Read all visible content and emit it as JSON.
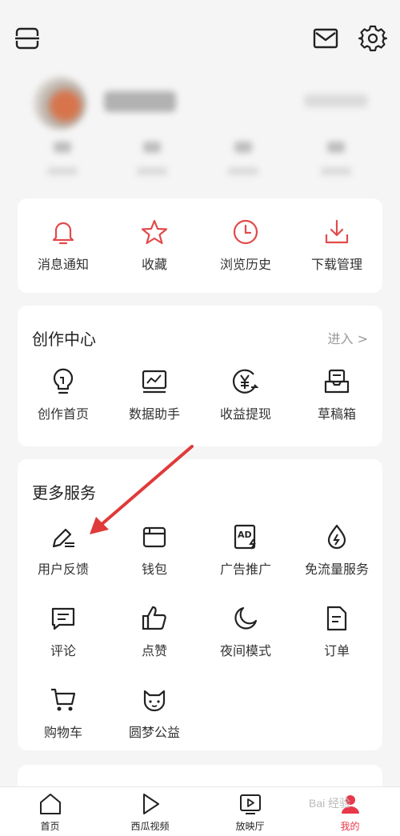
{
  "colors": {
    "accent_red": "#e24a4a",
    "icon_dark": "#222222",
    "muted": "#999999",
    "background": "#f5f5f5"
  },
  "topbar": {
    "scan_icon": "scan-icon",
    "mail_icon": "mail-icon",
    "settings_icon": "gear-icon"
  },
  "profile": {
    "blurred": true,
    "avatar_icon": "avatar"
  },
  "quick_actions": [
    {
      "label": "消息通知",
      "icon": "bell-icon"
    },
    {
      "label": "收藏",
      "icon": "star-icon"
    },
    {
      "label": "浏览历史",
      "icon": "clock-icon"
    },
    {
      "label": "下载管理",
      "icon": "download-icon"
    }
  ],
  "creator": {
    "title": "创作中心",
    "enter": "进入 >",
    "items": [
      {
        "label": "创作首页",
        "icon": "lightbulb-icon"
      },
      {
        "label": "数据助手",
        "icon": "chart-icon"
      },
      {
        "label": "收益提现",
        "icon": "yuan-icon"
      },
      {
        "label": "草稿箱",
        "icon": "inbox-icon"
      }
    ]
  },
  "services": {
    "title": "更多服务",
    "items": [
      {
        "label": "用户反馈",
        "icon": "edit-icon"
      },
      {
        "label": "钱包",
        "icon": "wallet-icon"
      },
      {
        "label": "广告推广",
        "icon": "ad-icon"
      },
      {
        "label": "免流量服务",
        "icon": "drop-icon"
      },
      {
        "label": "评论",
        "icon": "comment-icon"
      },
      {
        "label": "点赞",
        "icon": "thumb-up-icon"
      },
      {
        "label": "夜间模式",
        "icon": "moon-icon"
      },
      {
        "label": "订单",
        "icon": "document-icon"
      },
      {
        "label": "购物车",
        "icon": "cart-icon"
      },
      {
        "label": "圆梦公益",
        "icon": "cat-icon"
      }
    ]
  },
  "bottom_nav": [
    {
      "label": "首页",
      "icon": "home-icon"
    },
    {
      "label": "西瓜视频",
      "icon": "play-icon"
    },
    {
      "label": "放映厅",
      "icon": "tv-icon"
    },
    {
      "label": "我的",
      "icon": "profile-icon"
    }
  ],
  "watermark": "Bai 经验"
}
